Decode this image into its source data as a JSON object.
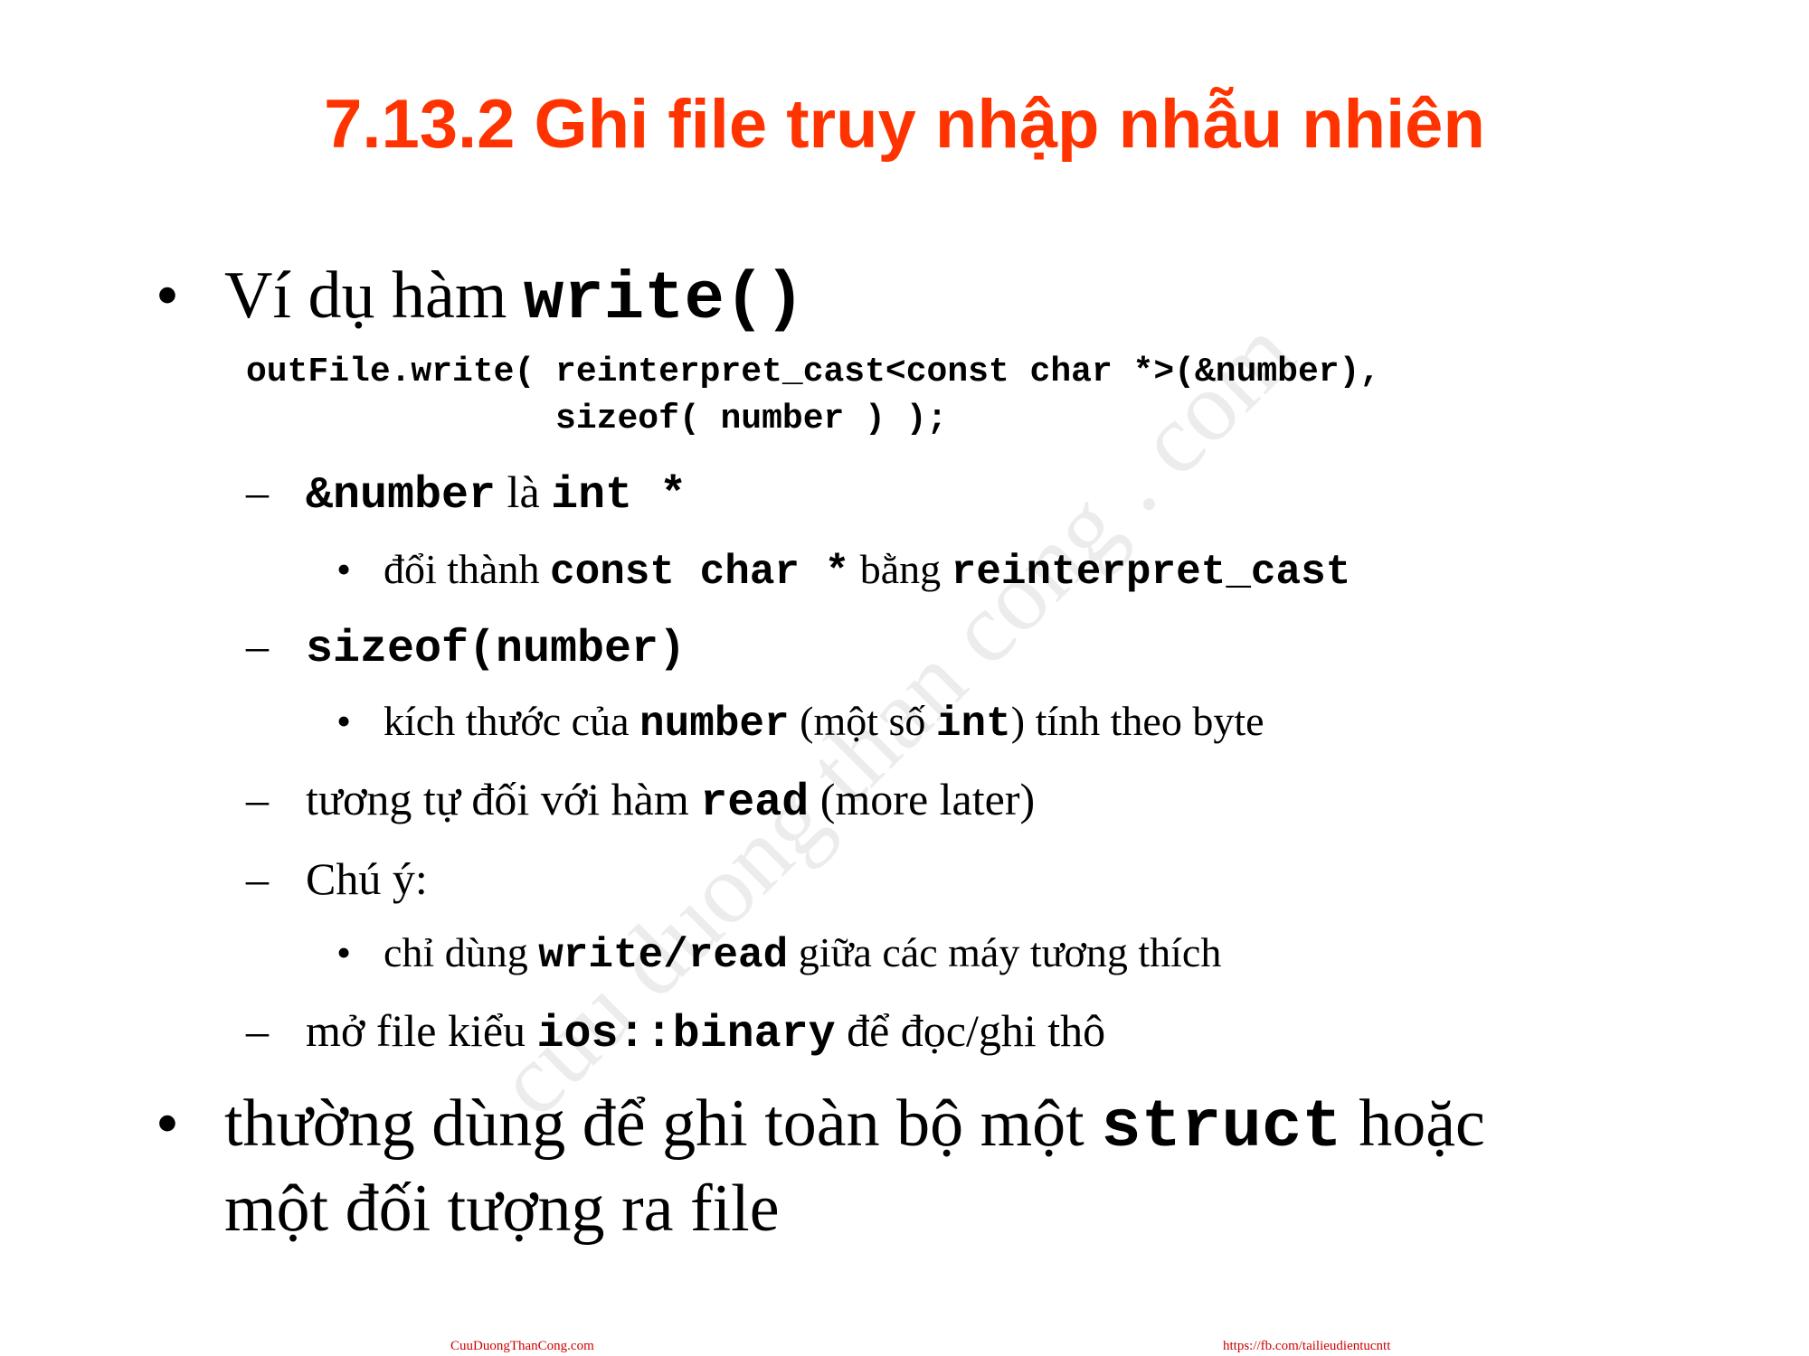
{
  "title": "7.13.2  Ghi file truy nhập nhẫu nhiên",
  "watermark": "cuu duong than cong . com",
  "bullet_symbol": "•",
  "dash_symbol": "–",
  "bullet1": {
    "text": "Ví dụ hàm ",
    "code": "write()"
  },
  "code_lines": [
    "outFile.write( reinterpret_cast<const char *>(&number),",
    "               sizeof( number ) );"
  ],
  "sub1": {
    "code1": "&number",
    "text1": " là ",
    "code2": "int *"
  },
  "sub1_item": {
    "text1": "đổi thành ",
    "code1": "const char *",
    "text2": " bằng ",
    "code2": "reinterpret_cast"
  },
  "sub2": {
    "code1": "sizeof(number)"
  },
  "sub2_item": {
    "text1": "kích thước của ",
    "code1": "number",
    "text2": " (một số ",
    "code2": "int",
    "text3": ") tính theo byte"
  },
  "sub3": {
    "text1": "tương tự đối với hàm ",
    "code1": "read",
    "text2": " (more later)"
  },
  "sub4": {
    "text1": "Chú ý:"
  },
  "sub4_item": {
    "text1": "chỉ dùng ",
    "code1": "write/read",
    "text2": " giữa các máy tương thích"
  },
  "sub5": {
    "text1": "mở file kiểu ",
    "code1": "ios::binary",
    "text2": " để đọc/ghi thô"
  },
  "bullet2": {
    "text1": "thường dùng để ghi toàn bộ một ",
    "code1": "struct",
    "text2": " hoặc",
    "line2": "một đối tượng ra file"
  },
  "footer": {
    "left": "CuuDuongThanCong.com",
    "right": "https://fb.com/tailieudientucntt"
  },
  "colors": {
    "title": "#ff3300",
    "footer": "#cc0000"
  }
}
